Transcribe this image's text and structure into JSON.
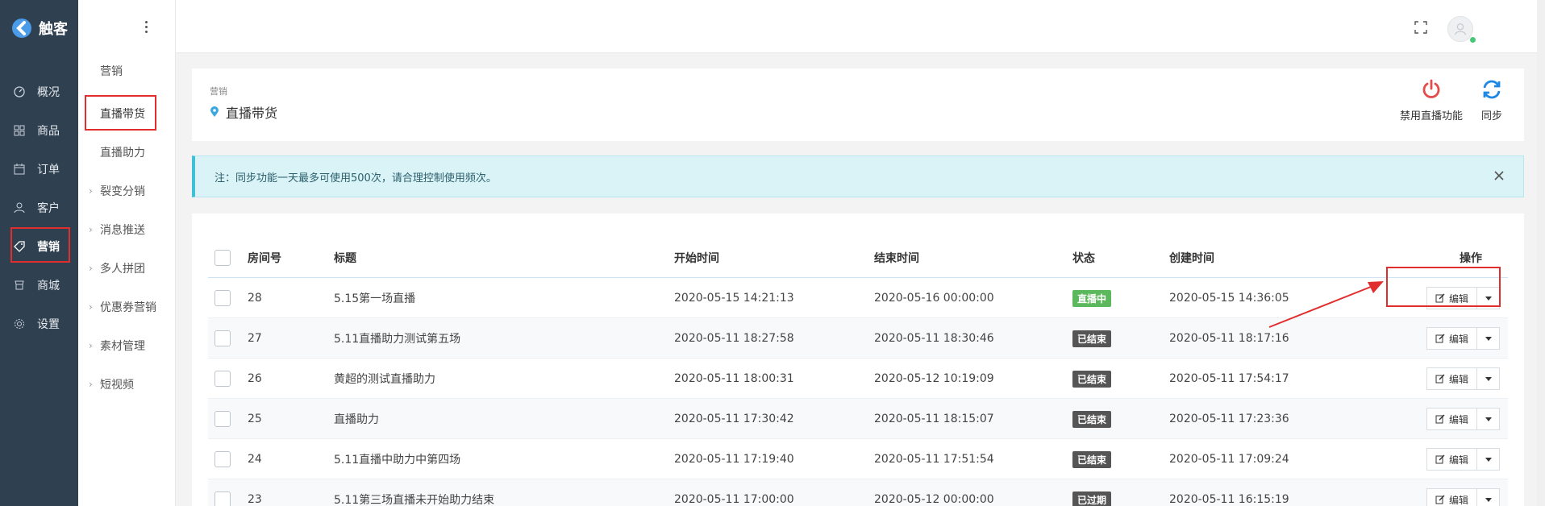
{
  "brand": {
    "name": "触客"
  },
  "nav": {
    "items": [
      {
        "label": "概况",
        "icon": "gauge-icon"
      },
      {
        "label": "商品",
        "icon": "grid-icon"
      },
      {
        "label": "订单",
        "icon": "calendar-icon"
      },
      {
        "label": "客户",
        "icon": "user-icon"
      },
      {
        "label": "营销",
        "icon": "tag-icon",
        "active": true
      },
      {
        "label": "商城",
        "icon": "shop-icon"
      },
      {
        "label": "设置",
        "icon": "gear-icon"
      }
    ]
  },
  "subnav": {
    "items": [
      {
        "label": "营销"
      },
      {
        "label": "直播带货",
        "active": true
      },
      {
        "label": "直播助力"
      },
      {
        "label": "裂变分销",
        "caret": "›"
      },
      {
        "label": "消息推送",
        "caret": "›"
      },
      {
        "label": "多人拼团",
        "caret": "›"
      },
      {
        "label": "优惠券营销",
        "caret": "›"
      },
      {
        "label": "素材管理",
        "caret": "›"
      },
      {
        "label": "短视频",
        "caret": "›"
      }
    ]
  },
  "header": {
    "breadcrumb": "营销",
    "title": "直播带货",
    "actions": [
      {
        "label": "禁用直播功能",
        "icon": "power-icon",
        "color": "#e54b4b"
      },
      {
        "label": "同步",
        "icon": "sync-icon",
        "color": "#1e88e5"
      }
    ]
  },
  "alert": {
    "text": "注：同步功能一天最多可使用500次，请合理控制使用频次。",
    "close_icon": "close-icon"
  },
  "table": {
    "columns": {
      "room": "房间号",
      "title": "标题",
      "start": "开始时间",
      "end": "结束时间",
      "status": "状态",
      "created": "创建时间",
      "ops": "操作"
    },
    "edit_label": "编辑",
    "rows": [
      {
        "room": "28",
        "title": "5.15第一场直播",
        "start": "2020-05-15 14:21:13",
        "end": "2020-05-16 00:00:00",
        "status": "直播中",
        "status_color": "#5cb85c",
        "created": "2020-05-15 14:36:05"
      },
      {
        "room": "27",
        "title": "5.11直播助力测试第五场",
        "start": "2020-05-11 18:27:58",
        "end": "2020-05-11 18:30:46",
        "status": "已结束",
        "status_color": "#555555",
        "created": "2020-05-11 18:17:16"
      },
      {
        "room": "26",
        "title": "黄超的测试直播助力",
        "start": "2020-05-11 18:00:31",
        "end": "2020-05-12 10:19:09",
        "status": "已结束",
        "status_color": "#555555",
        "created": "2020-05-11 17:54:17"
      },
      {
        "room": "25",
        "title": "直播助力",
        "start": "2020-05-11 17:30:42",
        "end": "2020-05-11 18:15:07",
        "status": "已结束",
        "status_color": "#555555",
        "created": "2020-05-11 17:23:36"
      },
      {
        "room": "24",
        "title": "5.11直播中助力中第四场",
        "start": "2020-05-11 17:19:40",
        "end": "2020-05-11 17:51:54",
        "status": "已结束",
        "status_color": "#555555",
        "created": "2020-05-11 17:09:24"
      },
      {
        "room": "23",
        "title": "5.11第三场直播未开始助力结束",
        "start": "2020-05-11 17:00:00",
        "end": "2020-05-12 00:00:00",
        "status": "已过期",
        "status_color": "#555555",
        "created": "2020-05-11 16:15:19"
      }
    ]
  }
}
